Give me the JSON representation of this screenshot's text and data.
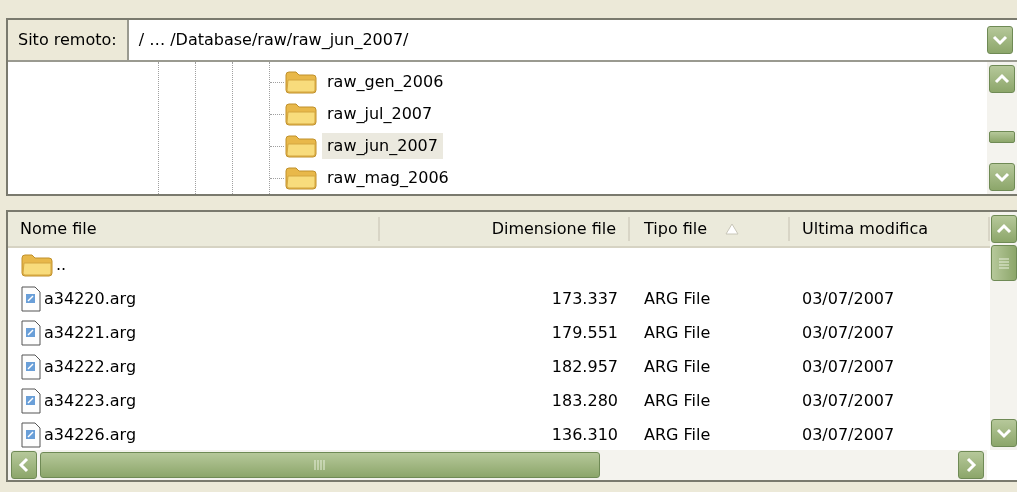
{
  "address": {
    "label": "Sito remoto:",
    "path": "/ … /Database/raw/raw_jun_2007/"
  },
  "tree": [
    {
      "label": "raw_gen_2006",
      "selected": false
    },
    {
      "label": "raw_jul_2007",
      "selected": false
    },
    {
      "label": "raw_jun_2007",
      "selected": true
    },
    {
      "label": "raw_mag_2006",
      "selected": false
    }
  ],
  "columns": [
    {
      "label": "Nome file",
      "sorted": false
    },
    {
      "label": "Dimensione file",
      "sorted": false
    },
    {
      "label": "Tipo file",
      "sorted": true
    },
    {
      "label": "Ultima modifica",
      "sorted": false
    }
  ],
  "rows": [
    {
      "kind": "folder",
      "name": ".."
    },
    {
      "kind": "file",
      "name": "a34220.arg",
      "size": "173.337",
      "type": "ARG File",
      "modified": "03/07/2007"
    },
    {
      "kind": "file",
      "name": "a34221.arg",
      "size": "179.551",
      "type": "ARG File",
      "modified": "03/07/2007"
    },
    {
      "kind": "file",
      "name": "a34222.arg",
      "size": "182.957",
      "type": "ARG File",
      "modified": "03/07/2007"
    },
    {
      "kind": "file",
      "name": "a34223.arg",
      "size": "183.280",
      "type": "ARG File",
      "modified": "03/07/2007"
    },
    {
      "kind": "file",
      "name": "a34226.arg",
      "size": "136.310",
      "type": "ARG File",
      "modified": "03/07/2007"
    }
  ]
}
